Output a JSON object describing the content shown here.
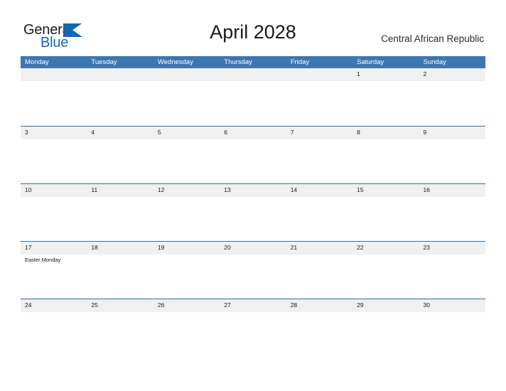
{
  "brand": {
    "name_part1": "General",
    "name_part2": "Blue",
    "flag_icon": "blue-triangle-flag-icon",
    "accent_color": "#1567b0"
  },
  "header": {
    "title": "April 2028",
    "region": "Central African Republic"
  },
  "colors": {
    "header_blue": "#3c77b0",
    "row_band_gray": "#f0f0f0",
    "row_separator_blue": "#2f6da4",
    "text_dark": "#1a1a1a",
    "weekday_text": "#ffffff"
  },
  "calendar": {
    "weekdays": [
      "Monday",
      "Tuesday",
      "Wednesday",
      "Thursday",
      "Friday",
      "Saturday",
      "Sunday"
    ],
    "weeks": [
      {
        "days": [
          {
            "num": "",
            "events": []
          },
          {
            "num": "",
            "events": []
          },
          {
            "num": "",
            "events": []
          },
          {
            "num": "",
            "events": []
          },
          {
            "num": "",
            "events": []
          },
          {
            "num": "1",
            "events": []
          },
          {
            "num": "2",
            "events": []
          }
        ]
      },
      {
        "days": [
          {
            "num": "3",
            "events": []
          },
          {
            "num": "4",
            "events": []
          },
          {
            "num": "5",
            "events": []
          },
          {
            "num": "6",
            "events": []
          },
          {
            "num": "7",
            "events": []
          },
          {
            "num": "8",
            "events": []
          },
          {
            "num": "9",
            "events": []
          }
        ]
      },
      {
        "days": [
          {
            "num": "10",
            "events": []
          },
          {
            "num": "11",
            "events": []
          },
          {
            "num": "12",
            "events": []
          },
          {
            "num": "13",
            "events": []
          },
          {
            "num": "14",
            "events": []
          },
          {
            "num": "15",
            "events": []
          },
          {
            "num": "16",
            "events": []
          }
        ]
      },
      {
        "days": [
          {
            "num": "17",
            "events": [
              "Easter Monday"
            ]
          },
          {
            "num": "18",
            "events": []
          },
          {
            "num": "19",
            "events": []
          },
          {
            "num": "20",
            "events": []
          },
          {
            "num": "21",
            "events": []
          },
          {
            "num": "22",
            "events": []
          },
          {
            "num": "23",
            "events": []
          }
        ]
      },
      {
        "days": [
          {
            "num": "24",
            "events": []
          },
          {
            "num": "25",
            "events": []
          },
          {
            "num": "26",
            "events": []
          },
          {
            "num": "27",
            "events": []
          },
          {
            "num": "28",
            "events": []
          },
          {
            "num": "29",
            "events": []
          },
          {
            "num": "30",
            "events": []
          }
        ]
      }
    ]
  }
}
